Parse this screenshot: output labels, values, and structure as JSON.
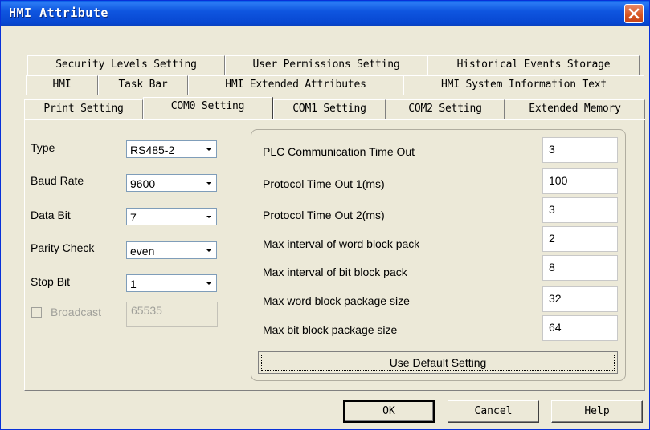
{
  "window": {
    "title": "HMI Attribute"
  },
  "tabs": {
    "row1": [
      "Security Levels Setting",
      "User Permissions Setting",
      "Historical Events Storage"
    ],
    "row2": [
      "HMI",
      "Task Bar",
      "HMI Extended Attributes",
      "HMI System Information Text"
    ],
    "row3": [
      "Print Setting",
      "COM0 Setting",
      "COM1 Setting",
      "COM2 Setting",
      "Extended Memory"
    ],
    "active": "COM0 Setting"
  },
  "left": {
    "type": {
      "label": "Type",
      "value": "RS485-2"
    },
    "baud": {
      "label": "Baud Rate",
      "value": "9600"
    },
    "databit": {
      "label": "Data Bit",
      "value": "7"
    },
    "parity": {
      "label": "Parity Check",
      "value": "even"
    },
    "stopbit": {
      "label": "Stop Bit",
      "value": "1"
    },
    "broadcast": {
      "label": "Broadcast",
      "value": "65535",
      "checked": false,
      "enabled": false
    }
  },
  "right": {
    "rows": [
      {
        "label": "PLC Communication Time Out",
        "value": "3"
      },
      {
        "label": "Protocol Time Out 1(ms)",
        "value": "100"
      },
      {
        "label": "Protocol Time Out 2(ms)",
        "value": "3"
      },
      {
        "label": "Max interval of word block pack",
        "value": "2"
      },
      {
        "label": "Max interval of bit block pack",
        "value": "8"
      },
      {
        "label": "Max word block package size",
        "value": "32"
      },
      {
        "label": "Max bit block package size",
        "value": "64"
      }
    ],
    "default_button": "Use Default Setting"
  },
  "buttons": {
    "ok": "OK",
    "cancel": "Cancel",
    "help": "Help"
  },
  "colors": {
    "titlebar": "#0747d1",
    "close": "#d6541f",
    "face": "#ece9d8"
  }
}
